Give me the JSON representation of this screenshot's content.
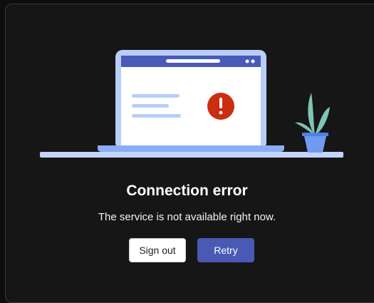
{
  "error": {
    "title": "Connection error",
    "message": "The service is not available right now."
  },
  "actions": {
    "sign_out_label": "Sign out",
    "retry_label": "Retry"
  },
  "illustration": {
    "icons": [
      "laptop-icon",
      "error-icon",
      "plant-icon"
    ],
    "colors": {
      "laptop_frame": "#b9cdfa",
      "laptop_header": "#4a5ab8",
      "error_red": "#cc2d10",
      "plant_leaf": "#7fc4b4",
      "pot": "#6f9bf0",
      "shelf": "#c4d5fb"
    }
  },
  "theme": {
    "background": "#161616",
    "primary": "#4a59b3"
  }
}
